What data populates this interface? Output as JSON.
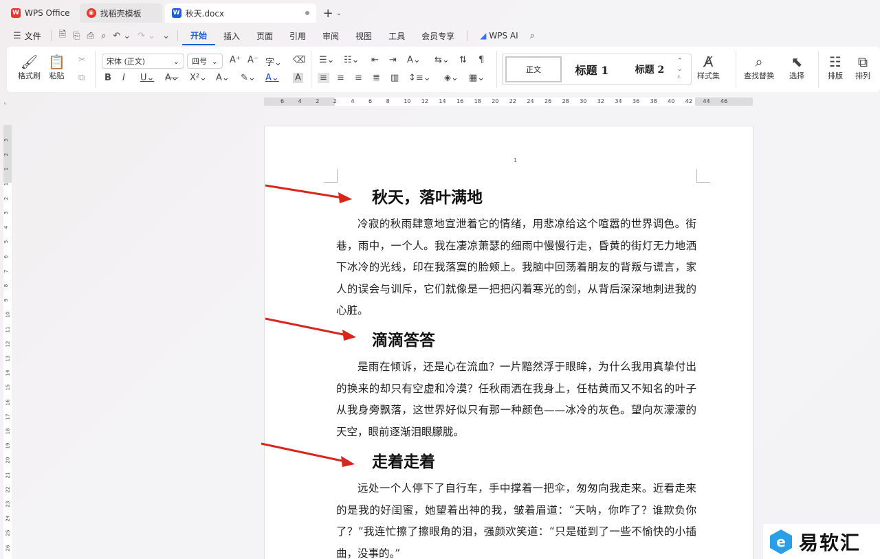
{
  "tabs": [
    {
      "label": "WPS Office",
      "icon": "wps-logo-icon"
    },
    {
      "label": "找稻壳模板",
      "icon": "docer-icon"
    },
    {
      "label": "秋天.docx",
      "icon": "word-doc-icon"
    }
  ],
  "menu": {
    "file": "文件",
    "items": [
      "开始",
      "插入",
      "页面",
      "引用",
      "审阅",
      "视图",
      "工具",
      "会员专享"
    ],
    "active": "开始",
    "wps_ai": "WPS AI"
  },
  "ribbon": {
    "format_painter": "格式刷",
    "paste": "粘贴",
    "font_name": "宋体 (正文)",
    "font_size": "四号",
    "style_normal": "正文",
    "style_h1": "标题 1",
    "style_h2": "标题 2",
    "style_set": "样式集",
    "find_replace": "查找替换",
    "select": "选择",
    "layout": "排版",
    "arrange": "排列"
  },
  "ruler": {
    "h_ticks": [
      "6",
      "4",
      "2",
      "2",
      "4",
      "6",
      "8",
      "10",
      "12",
      "14",
      "16",
      "18",
      "20",
      "22",
      "24",
      "26",
      "28",
      "30",
      "32",
      "34",
      "36",
      "38",
      "40",
      "42",
      "44",
      "46"
    ],
    "v_ticks": [
      "3",
      "2",
      "1",
      "1",
      "2",
      "3",
      "4",
      "5",
      "6",
      "7",
      "8",
      "9",
      "10",
      "11",
      "12",
      "13",
      "14",
      "15",
      "16",
      "17",
      "18",
      "19",
      "20",
      "21",
      "22",
      "23",
      "24",
      "25",
      "26"
    ]
  },
  "document": {
    "page_number": "1",
    "sections": [
      {
        "heading": "秋天，落叶满地",
        "paragraph": "冷寂的秋雨肆意地宣泄着它的情绪，用悲凉给这个喧嚣的世界调色。街巷，雨中，一个人。我在凄凉萧瑟的细雨中慢慢行走，昏黄的街灯无力地洒下冰冷的光线，印在我落寞的脸颊上。我脑中回荡着朋友的背叛与谎言，家人的误会与训斥，它们就像是一把把闪着寒光的剑，从背后深深地刺进我的心脏。"
      },
      {
        "heading": "滴滴答答",
        "paragraph": "是雨在倾诉，还是心在流血？一片黯然浮于眼眸，为什么我用真挚付出的换来的却只有空虚和冷漠？任秋雨洒在我身上，任枯黄而又不知名的叶子从我身旁飘落，这世界好似只有那一种颜色——冰冷的灰色。望向灰濛濛的天空，眼前逐渐泪眼朦胧。"
      },
      {
        "heading": "走着走着",
        "paragraph": "远处一个人停下了自行车，手中撑着一把伞，匆匆向我走来。近看走来的是我的好闺蜜，她望着出神的我，皱着眉道：“天呐，你咋了？谁欺负你了？”我连忙擦了擦眼角的泪，强颜欢笑道：“只是碰到了一些不愉快的小插曲，没事的。”"
      }
    ]
  },
  "watermark": {
    "text": "易软汇"
  },
  "colors": {
    "accent": "#1a5fd6",
    "arrow": "#d9261c",
    "wps_red": "#e8352e"
  }
}
